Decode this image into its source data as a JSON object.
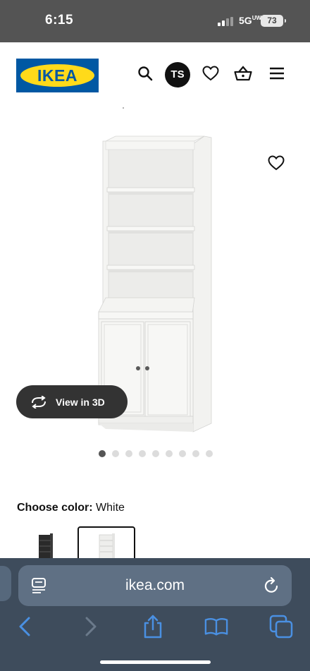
{
  "status_bar": {
    "time": "6:15",
    "network": "5G",
    "network_sup": "UW",
    "battery": "73"
  },
  "header": {
    "logo_text": "IKEA",
    "avatar_initials": "TS",
    "icons": [
      "search-icon",
      "heart-icon",
      "basket-icon",
      "menu-icon"
    ]
  },
  "product": {
    "view_3d_label": "View in 3D",
    "carousel": {
      "total": 9,
      "active": 1
    }
  },
  "color": {
    "label": "Choose color:",
    "value": "White",
    "options": [
      "black",
      "white"
    ],
    "selected": "white"
  },
  "browser": {
    "url": "ikea.com"
  },
  "colors": {
    "ikea_blue": "#0058a3",
    "ikea_yellow": "#ffda1a",
    "status_bar": "#545454",
    "safari_bar": "#3e4c5c",
    "safari_icons": "#4a90e2"
  }
}
